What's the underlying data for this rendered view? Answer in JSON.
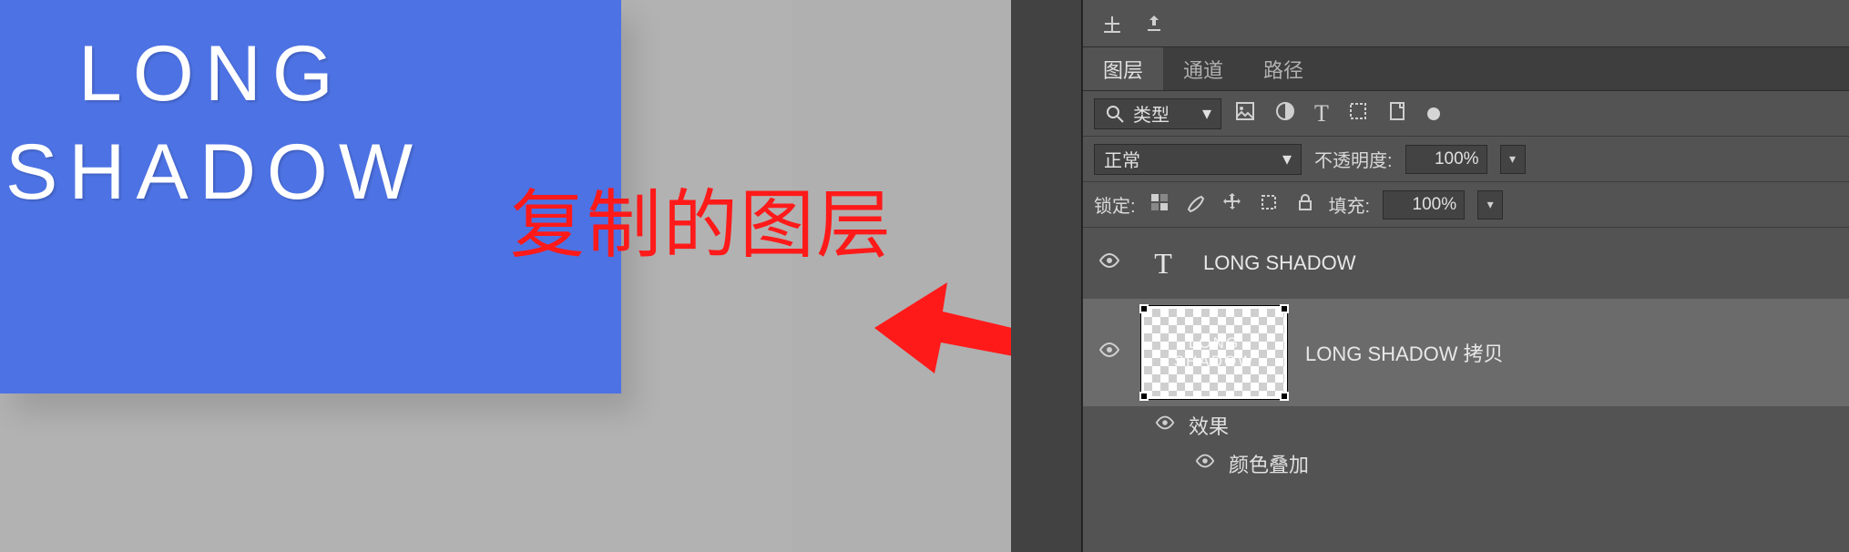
{
  "canvas": {
    "line1": "LONG",
    "line2": "SHADOW"
  },
  "annotation": "复制的图层",
  "panel": {
    "tabs": {
      "layers": "图层",
      "channels": "通道",
      "paths": "路径"
    },
    "filter_label": "类型",
    "blend_mode": "正常",
    "opacity_label": "不透明度:",
    "opacity_value": "100%",
    "lock_label": "锁定:",
    "fill_label": "填充:",
    "fill_value": "100%",
    "layers": [
      {
        "name": "LONG SHADOW"
      },
      {
        "name": "LONG SHADOW 拷贝",
        "thumb_line1": "LONG",
        "thumb_line2": "SHADOW"
      }
    ],
    "fx": {
      "effects": "效果",
      "color_overlay": "颜色叠加"
    }
  }
}
